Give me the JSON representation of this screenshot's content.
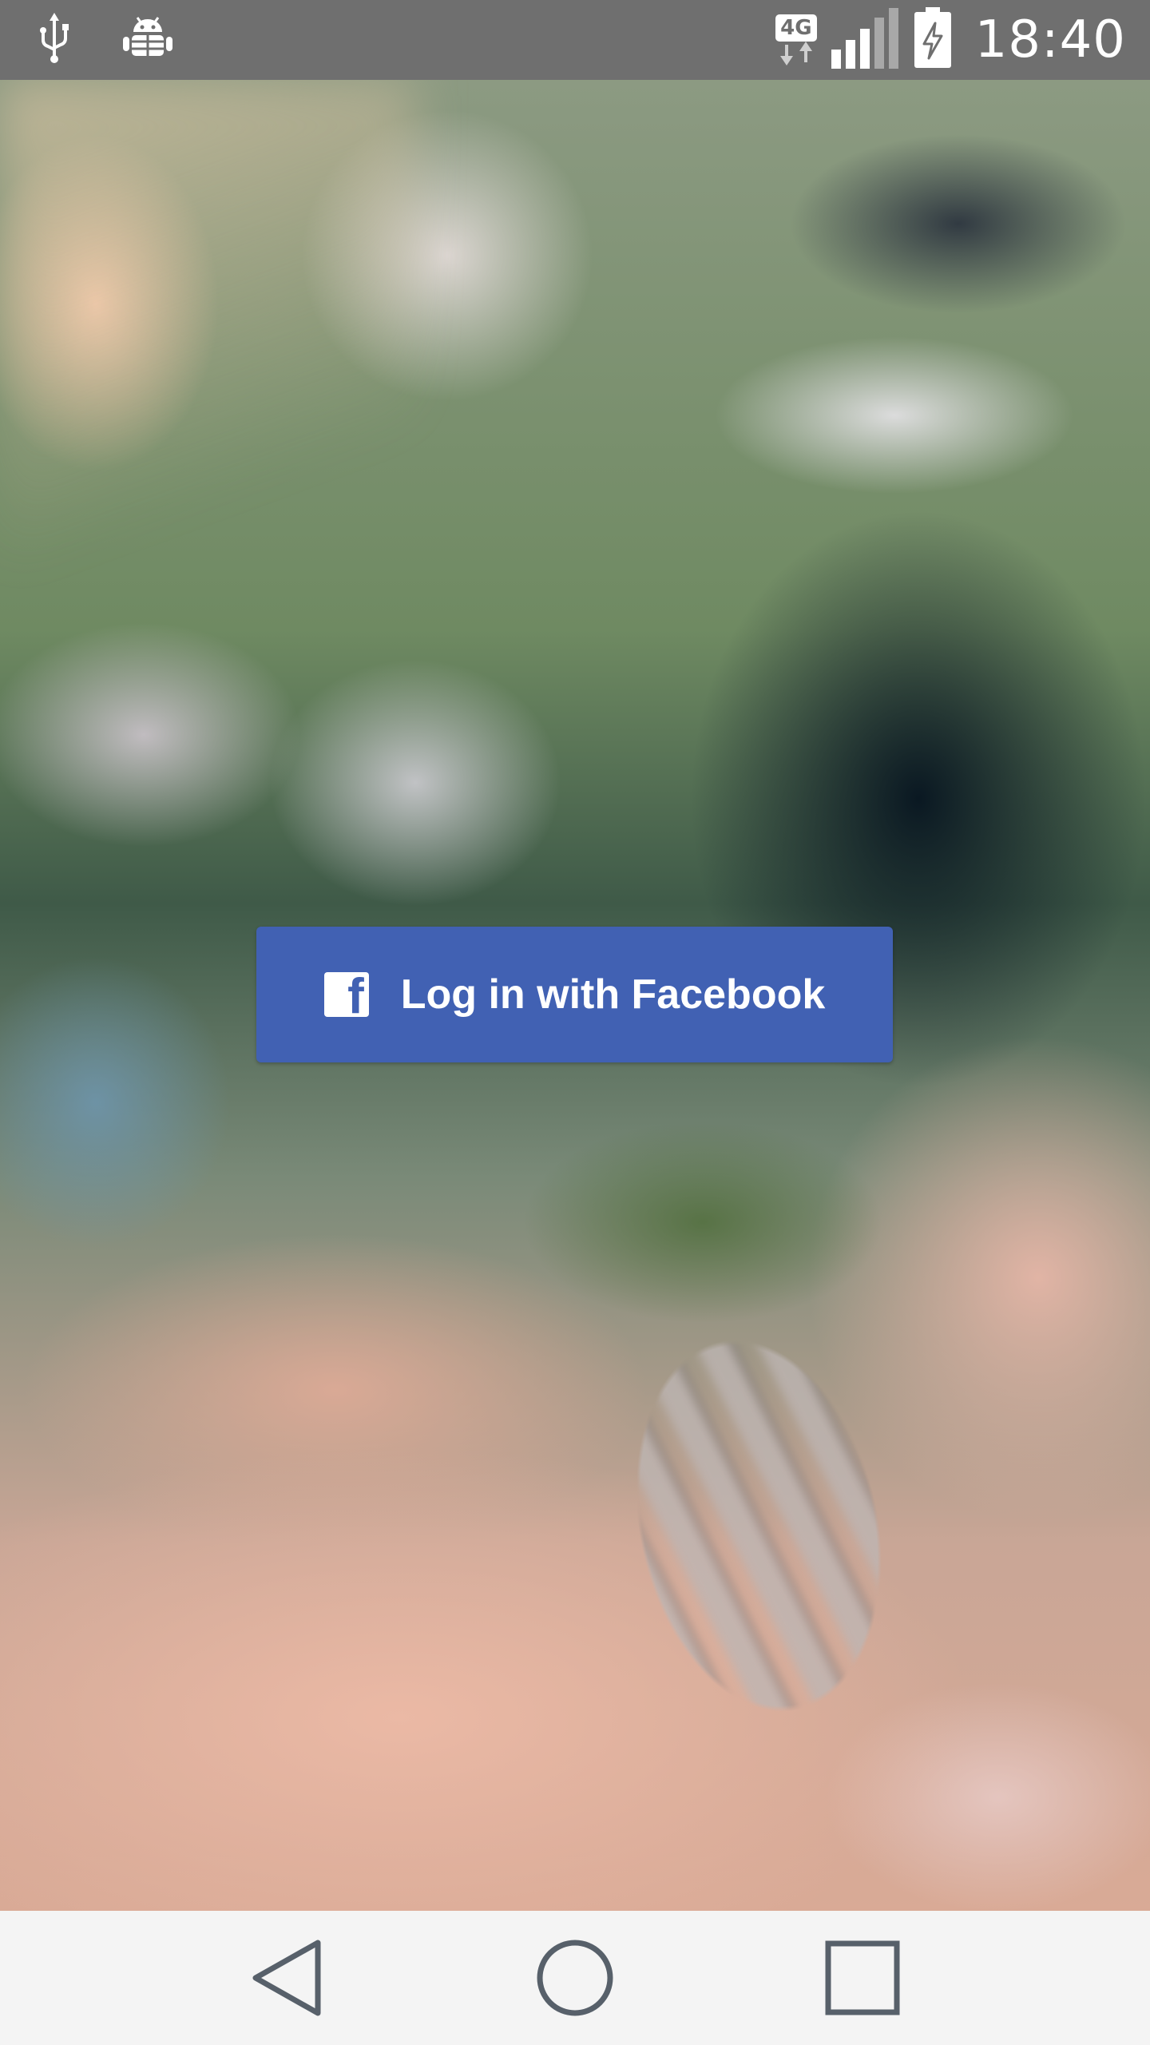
{
  "status_bar": {
    "time": "18:40",
    "network_type": "4G",
    "icons": [
      "usb-icon",
      "android-debug-icon",
      "network-4g-icon",
      "signal-icon",
      "battery-charging-icon"
    ]
  },
  "login": {
    "button_label": "Log in with Facebook",
    "icon": "facebook-icon",
    "brand_color": "#4161b3"
  },
  "nav_bar": {
    "buttons": [
      "back",
      "home",
      "recents"
    ]
  },
  "colors": {
    "status_bar_bg": "#6f6f6f",
    "nav_bar_bg": "#f4f4f4",
    "nav_icon": "#57606a"
  }
}
